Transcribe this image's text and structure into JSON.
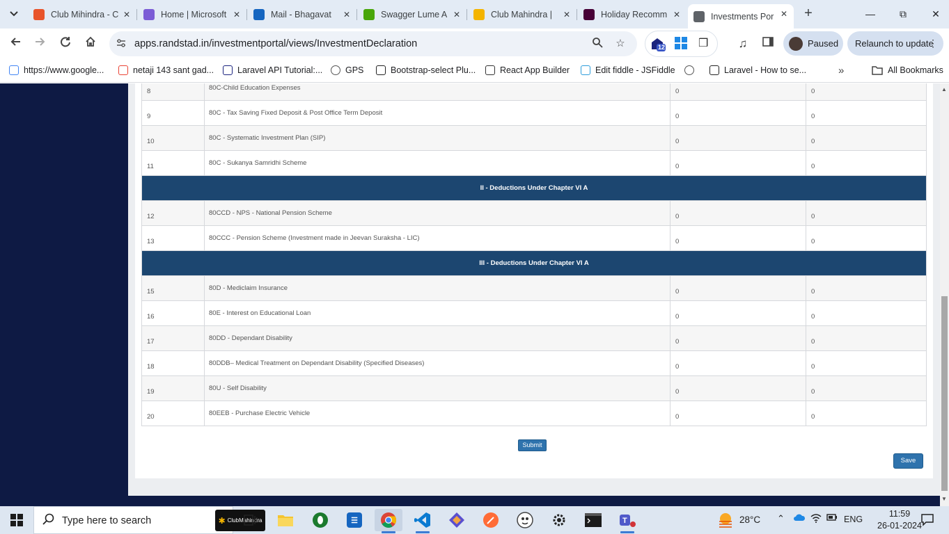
{
  "browser": {
    "tabs": [
      {
        "title": "Club Mihindra - C",
        "icon": "club-mahindra-icon",
        "color": "#e8542b"
      },
      {
        "title": "Home | Microsoft",
        "icon": "microsoft-icon",
        "color": "#7b5cd6"
      },
      {
        "title": "Mail - Bhagavat",
        "icon": "outlook-icon",
        "color": "#1565c0"
      },
      {
        "title": "Swagger Lume A",
        "icon": "swagger-icon",
        "color": "#49a60a"
      },
      {
        "title": "Club Mahindra |",
        "icon": "club-mahindra-pinwheel-icon",
        "color": "#f4b400"
      },
      {
        "title": "Holiday Recomm",
        "icon": "adobe-xd-icon",
        "color": "#470137"
      },
      {
        "title": "Investments Por",
        "icon": "globe-icon",
        "color": "#5f6368",
        "active": true
      }
    ],
    "url": "apps.randstad.in/investmentportal/views/InvestmentDeclaration",
    "extensions_badge": "12",
    "profile_label": "Paused",
    "relaunch_label": "Relaunch to update",
    "bookmarks": [
      {
        "label": "https://www.google...",
        "icon": "google-icon"
      },
      {
        "label": "netaji 143 sant gad...",
        "icon": "gmail-icon"
      },
      {
        "label": "Laravel API Tutorial:...",
        "icon": "laravel-tutorial-icon"
      },
      {
        "label": "GPS",
        "icon": "globe-icon"
      },
      {
        "label": "Bootstrap-select Plu...",
        "icon": "bootstrap-select-icon"
      },
      {
        "label": "React App Builder",
        "icon": "react-builder-icon"
      },
      {
        "label": "Edit fiddle - JSFiddle",
        "icon": "jsfiddle-icon"
      },
      {
        "label": "",
        "icon": "globe-icon"
      },
      {
        "label": "Laravel - How to se...",
        "icon": "laravel-icon"
      }
    ],
    "bookmarks_overflow": "»",
    "all_bookmarks_label": "All Bookmarks"
  },
  "table": {
    "rows": [
      {
        "type": "row",
        "sno": "8",
        "desc": "80C-Child Education Expenses",
        "declared": "0",
        "actual": "0"
      },
      {
        "type": "row",
        "sno": "9",
        "desc": "80C - Tax Saving Fixed Deposit & Post Office Term Deposit",
        "declared": "0",
        "actual": "0"
      },
      {
        "type": "row",
        "sno": "10",
        "desc": "80C - Systematic Investment Plan (SIP)",
        "declared": "0",
        "actual": "0"
      },
      {
        "type": "row",
        "sno": "11",
        "desc": "80C - Sukanya Samridhi Scheme",
        "declared": "0",
        "actual": "0"
      },
      {
        "type": "section",
        "title": "II - Deductions Under Chapter VI A"
      },
      {
        "type": "row",
        "sno": "12",
        "desc": "80CCD - NPS - National Pension Scheme",
        "declared": "0",
        "actual": "0"
      },
      {
        "type": "row",
        "sno": "13",
        "desc": "80CCC - Pension Scheme (Investment made in Jeevan Suraksha - LIC)",
        "declared": "0",
        "actual": "0"
      },
      {
        "type": "section",
        "title": "III - Deductions Under Chapter VI A"
      },
      {
        "type": "row",
        "sno": "15",
        "desc": "80D - Mediclaim Insurance",
        "declared": "0",
        "actual": "0"
      },
      {
        "type": "row",
        "sno": "16",
        "desc": "80E - Interest on Educational Loan",
        "declared": "0",
        "actual": "0"
      },
      {
        "type": "row",
        "sno": "17",
        "desc": "80DD - Dependant Disability",
        "declared": "0",
        "actual": "0"
      },
      {
        "type": "row",
        "sno": "18",
        "desc": "80DDB– Medical Treatment on Dependant Disability (Specified Diseases)",
        "declared": "0",
        "actual": "0"
      },
      {
        "type": "row",
        "sno": "19",
        "desc": "80U - Self Disability",
        "declared": "0",
        "actual": "0"
      },
      {
        "type": "row",
        "sno": "20",
        "desc": "80EEB - Purchase Electric Vehicle",
        "declared": "0",
        "actual": "0"
      }
    ]
  },
  "buttons": {
    "submit": "Submit",
    "save": "Save"
  },
  "colors": {
    "section_header_bg": "#1c4670",
    "button_bg": "#2f73ad",
    "sidebar_bg": "#0e1a44"
  },
  "taskbar": {
    "search_placeholder": "Type here to search",
    "search_widget_label": "ClubMahindra",
    "weather_temp": "28°C",
    "language": "ENG",
    "time": "11:59",
    "date": "26-01-2024"
  }
}
